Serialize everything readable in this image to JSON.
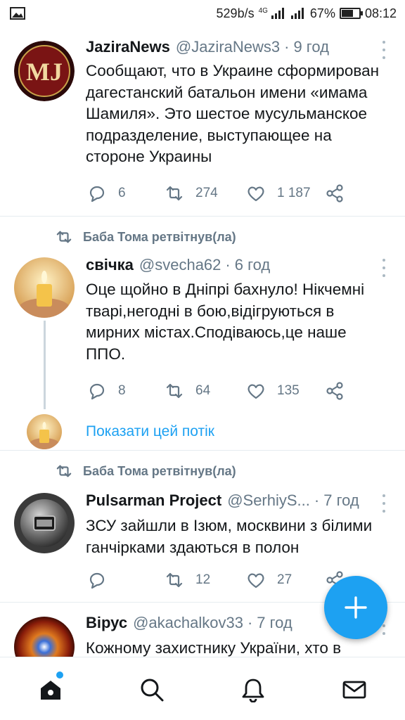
{
  "status_bar": {
    "net_speed": "529b/s",
    "network": "4G",
    "battery": "67%",
    "battery_level": 0.67,
    "time": "08:12"
  },
  "tweets": [
    {
      "name": "JaziraNews",
      "handle": "@JaziraNews3",
      "time": "9 год",
      "text": "Сообщают, что в Украине сформирован дагестанский батальон имени «имама Шамиля». Это шестое мусульманское подразделение, выступающее на стороне Украины",
      "replies": "6",
      "retweets": "274",
      "likes": "1 187",
      "avatar_text": "MJ"
    },
    {
      "retweeted_by": "Баба Тома ретвітнув(ла)",
      "name": "свічка",
      "handle": "@svecha62",
      "time": "6 год",
      "text": "Оце щойно в Дніпрі бахнуло! Нікчемні тварі,негодні в бою,відігруються в мирних містах.Сподіваюсь,це наше ППО.",
      "replies": "8",
      "retweets": "64",
      "likes": "135",
      "show_thread": "Показати цей потік"
    },
    {
      "retweeted_by": "Баба Тома ретвітнув(ла)",
      "name": "Pulsarman Project",
      "handle": "@SerhiyS...",
      "time": "7 год",
      "text": "ЗСУ зайшли в Ізюм, москвини з білими ганчірками здаються в полон",
      "replies": "",
      "retweets": "12",
      "likes": "27"
    },
    {
      "name": "Вірус",
      "handle": "@akachalkov33",
      "time": "7 год",
      "text": "Кожному захистнику України, хто в"
    }
  ],
  "colors": {
    "accent": "#1da1f2",
    "muted": "#657786",
    "divider": "#e6ecf0"
  },
  "icons": {
    "reply": "speech-bubble-icon",
    "retweet": "retweet-icon",
    "like": "heart-icon",
    "share": "share-icon",
    "compose": "plus-icon",
    "nav": [
      "home-icon",
      "search-icon",
      "bell-icon",
      "mail-icon"
    ]
  }
}
